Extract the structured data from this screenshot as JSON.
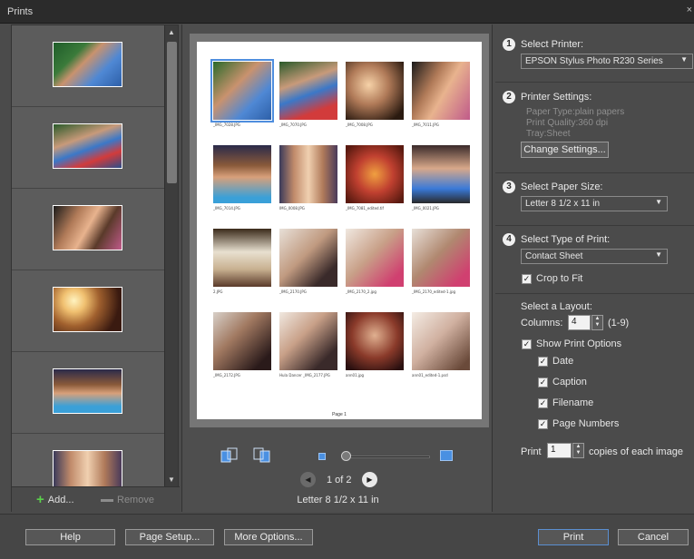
{
  "window": {
    "title": "Prints",
    "close": "×"
  },
  "left_panel": {
    "add_label": "Add...",
    "remove_label": "Remove"
  },
  "preview": {
    "page_footer": "Page 1",
    "pager_text": "1 of 2",
    "paper_label": "Letter 8 1/2 x 11 in",
    "captions": [
      "_IMG_7028.JPG",
      "_IMG_7070.JPG",
      "_IMG_7008.JPG",
      "_IMG_7011.JPG",
      "_IMG_7014.JPG",
      "IMG_0008.JPG",
      "_IMG_7081_edited.tif",
      "_IMG_0021.JPG",
      "2.JPG",
      "_IMG_2170.JPG",
      "_IMG_2170_2.jpg",
      "_IMG_2170_edited-1.jpg",
      "_IMG_2172.JPG",
      "Hula Dancer _IMG_2177.JPG",
      "ann01.jpg",
      "ann01_edited-1.psd"
    ]
  },
  "options": {
    "step1": {
      "num": "1",
      "title": "Select Printer:",
      "value": "EPSON Stylus Photo R230 Series"
    },
    "step2": {
      "num": "2",
      "title": "Printer Settings:",
      "paper_type": "Paper Type:plain papers",
      "print_quality": "Print Quality:360 dpi",
      "tray": "Tray:Sheet",
      "button": "Change Settings..."
    },
    "step3": {
      "num": "3",
      "title": "Select Paper Size:",
      "value": "Letter 8 1/2 x 11 in"
    },
    "step4": {
      "num": "4",
      "title": "Select Type of Print:",
      "value": "Contact Sheet",
      "crop_label": "Crop to Fit"
    },
    "layout": {
      "title": "Select a Layout:",
      "columns_label": "Columns:",
      "columns_value": "4",
      "columns_range": "(1-9)",
      "show_print_options": "Show Print Options",
      "date": "Date",
      "caption": "Caption",
      "filename": "Filename",
      "page_numbers": "Page Numbers"
    },
    "print_copies": {
      "label": "Print",
      "value": "1",
      "suffix": "copies of each image"
    }
  },
  "bottom": {
    "help": "Help",
    "page_setup": "Page Setup...",
    "more_options": "More Options...",
    "print": "Print",
    "cancel": "Cancel"
  },
  "colors": {
    "accent": "#4a90e2",
    "panel": "#4b4b4b",
    "titlebar": "#2b2b2b"
  }
}
